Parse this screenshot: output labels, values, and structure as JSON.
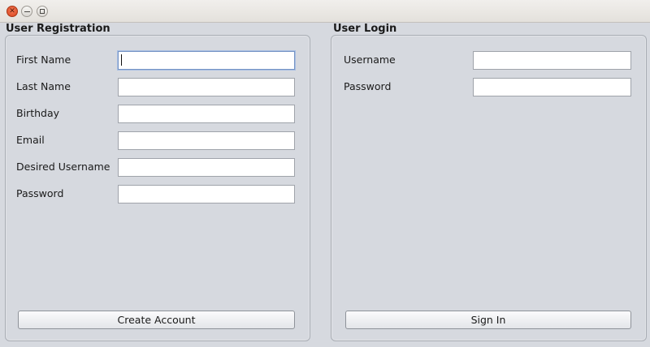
{
  "window": {
    "buttons": {
      "close_icon": "close-icon",
      "minimize_icon": "minimize-icon",
      "maximize_icon": "maximize-icon"
    }
  },
  "registration": {
    "title": "User Registration",
    "fields": [
      {
        "label": "First Name",
        "value": ""
      },
      {
        "label": "Last Name",
        "value": ""
      },
      {
        "label": "Birthday",
        "value": ""
      },
      {
        "label": "Email",
        "value": ""
      },
      {
        "label": "Desired Username",
        "value": ""
      },
      {
        "label": "Password",
        "value": ""
      }
    ],
    "submit_label": "Create Account"
  },
  "login": {
    "title": "User Login",
    "fields": [
      {
        "label": "Username",
        "value": ""
      },
      {
        "label": "Password",
        "value": ""
      }
    ],
    "submit_label": "Sign In"
  },
  "colors": {
    "background": "#d6d9df",
    "focus_border": "#7593c4",
    "close_button": "#e0542c"
  }
}
